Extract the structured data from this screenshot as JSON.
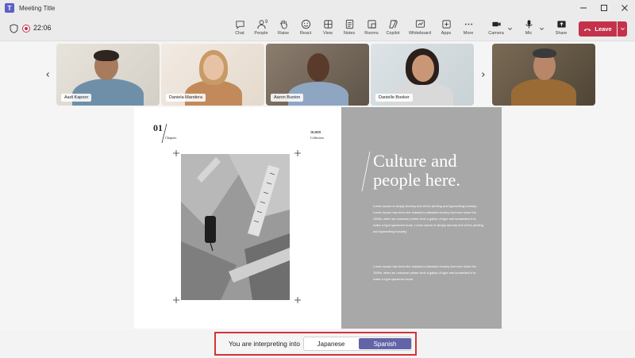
{
  "window": {
    "title": "Meeting Title",
    "logo_letter": "T"
  },
  "meeting": {
    "elapsed": "22:06",
    "people_count": "9"
  },
  "toolbar": {
    "chat": "Chat",
    "people": "People",
    "raise": "Raise",
    "react": "React",
    "view": "View",
    "notes": "Notes",
    "rooms": "Rooms",
    "copilot": "Copilot",
    "whiteboard": "Whiteboard",
    "apps": "Apps",
    "more": "More",
    "camera": "Camera",
    "mic": "Mic",
    "share": "Share",
    "leave": "Leave"
  },
  "participants": [
    {
      "name": "Aadi Kapoor"
    },
    {
      "name": "Daniela Mandera"
    },
    {
      "name": "Aaron Buxton"
    },
    {
      "name": "Danielle Booker"
    },
    {
      "name": ""
    }
  ],
  "slide": {
    "chapter_number": "01",
    "chapter_label": "Chapter",
    "date": "10.2019",
    "collection": "Collection",
    "headline_line1": "Culture and",
    "headline_line2": "people here.",
    "paragraph1": "Lorem Ipsum is simply dummy text of the printing and typesetting industry. Lorem Ipsum has been the industry's standard dummy text ever since the 1500s, when an unknown printer took a galley of type and scrambled it to make a type specimen book. Lorem Ipsum is simply dummy text of the printing and typesetting industry.",
    "paragraph2": "Lorem Ipsum has been the industry's standard dummy text ever since the 1500s, when an unknown printer took a galley of type and scrambled it to make a type specimen book."
  },
  "interpretation": {
    "label": "You are interpreting into",
    "options": [
      "Japanese",
      "Spanish"
    ],
    "selected": "Spanish"
  },
  "colors": {
    "leave": "#c4314b",
    "accent": "#6264a7",
    "highlight_border": "#d13438",
    "slide_panel": "#a8a8a8"
  }
}
